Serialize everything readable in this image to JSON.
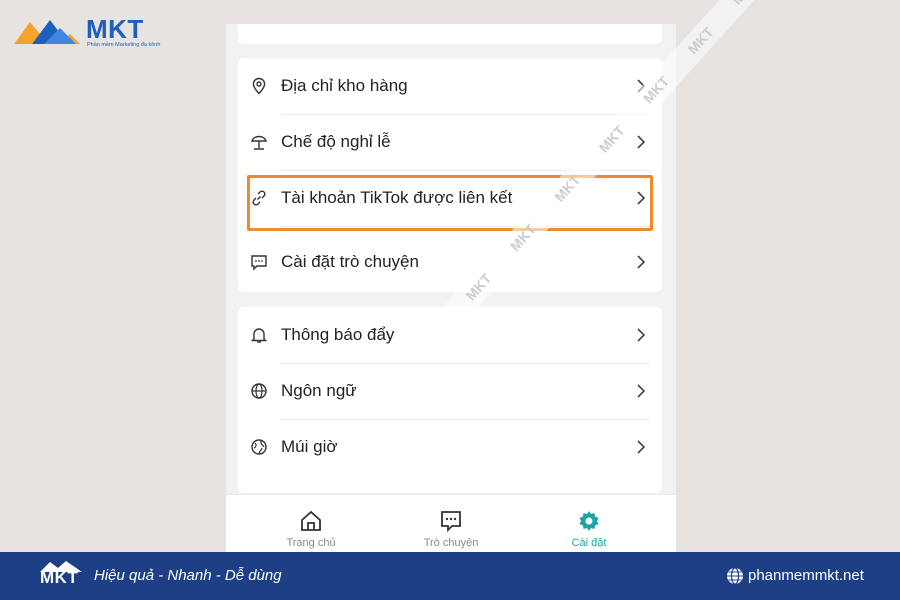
{
  "brand": {
    "logo_text": "MKT",
    "tagline": "Phần mềm Marketing đa kênh",
    "colors": {
      "blue": "#1d5fbf",
      "orange": "#f6a32b",
      "footer": "#1d3f86",
      "highlight": "#ef8b2e",
      "accent": "#1aa4a4"
    }
  },
  "settings": {
    "group1": [
      {
        "icon": "location-pin-icon",
        "label": "Địa chỉ kho hàng"
      },
      {
        "icon": "beach-umbrella-icon",
        "label": "Chế độ nghỉ lễ"
      },
      {
        "icon": "link-icon",
        "label": "Tài khoản TikTok được liên kết",
        "highlighted": true
      },
      {
        "icon": "chat-bubble-icon",
        "label": "Cài đặt trò chuyện"
      }
    ],
    "group2": [
      {
        "icon": "bell-icon",
        "label": "Thông báo đẩy"
      },
      {
        "icon": "globe-icon",
        "label": "Ngôn ngữ"
      },
      {
        "icon": "world-clock-icon",
        "label": "Múi giờ"
      }
    ]
  },
  "tabbar": {
    "tabs": [
      {
        "icon": "home-icon",
        "label": "Trang chủ",
        "active": false
      },
      {
        "icon": "chat-icon",
        "label": "Trò chuyện",
        "active": false
      },
      {
        "icon": "settings-gear-icon",
        "label": "Cài đặt",
        "active": true
      }
    ]
  },
  "watermark": {
    "text": "MKT"
  },
  "footer": {
    "logo_text": "MKT",
    "slogan": "Hiệu quả - Nhanh - Dễ dùng",
    "website": "phanmemmkt.net"
  }
}
